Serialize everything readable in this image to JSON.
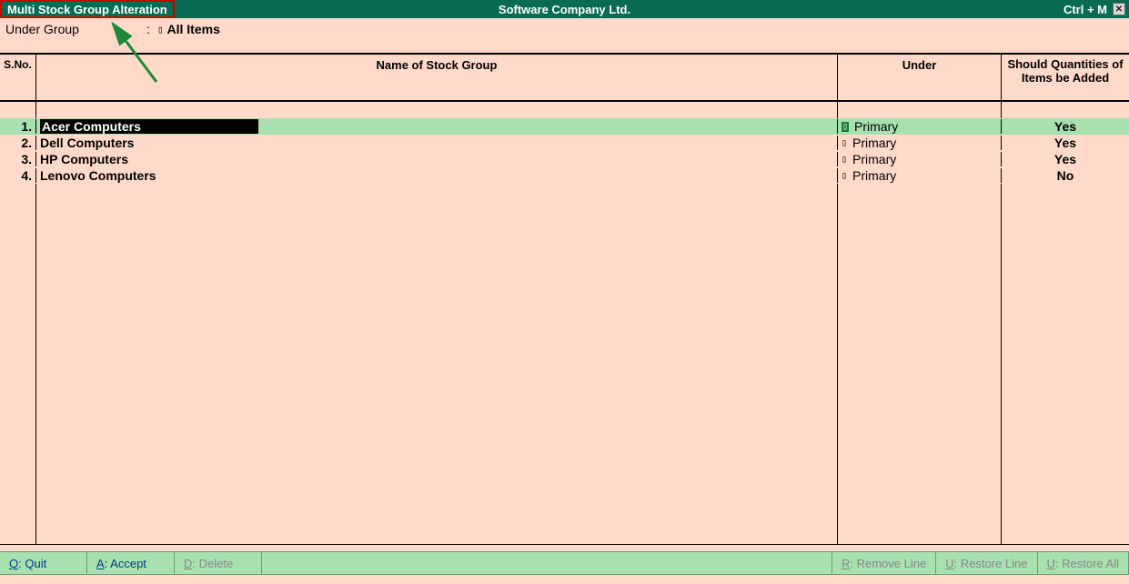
{
  "title_left": "Multi Stock Group Alteration",
  "title_center": "Software Company Ltd.",
  "title_shortcut": "Ctrl + M",
  "under_group_label": "Under Group",
  "under_group_value": "All Items",
  "headers": {
    "sno": "S.No.",
    "name": "Name of Stock Group",
    "under": "Under",
    "qty": "Should Quantities of Items be Added"
  },
  "rows": [
    {
      "sno": "1.",
      "name": "Acer Computers",
      "under": "Primary",
      "qty": "Yes",
      "highlight": true
    },
    {
      "sno": "2.",
      "name": "Dell Computers",
      "under": "Primary",
      "qty": "Yes",
      "highlight": false
    },
    {
      "sno": "3.",
      "name": "HP Computers",
      "under": "Primary",
      "qty": "Yes",
      "highlight": false
    },
    {
      "sno": "4.",
      "name": "Lenovo Computers",
      "under": "Primary",
      "qty": "No",
      "highlight": false
    }
  ],
  "buttons": {
    "quit": {
      "hot": "Q",
      "rest": ": Quit"
    },
    "accept": {
      "hot": "A",
      "rest": ": Accept"
    },
    "delete": {
      "hot": "D",
      "rest": ": Delete"
    },
    "remove": {
      "hot": "R",
      "rest": ": Remove Line"
    },
    "restore_line": {
      "hot": "U",
      "rest": ": Restore Line"
    },
    "restore_all": {
      "hot": "U",
      "rest": ": Restore All"
    }
  }
}
